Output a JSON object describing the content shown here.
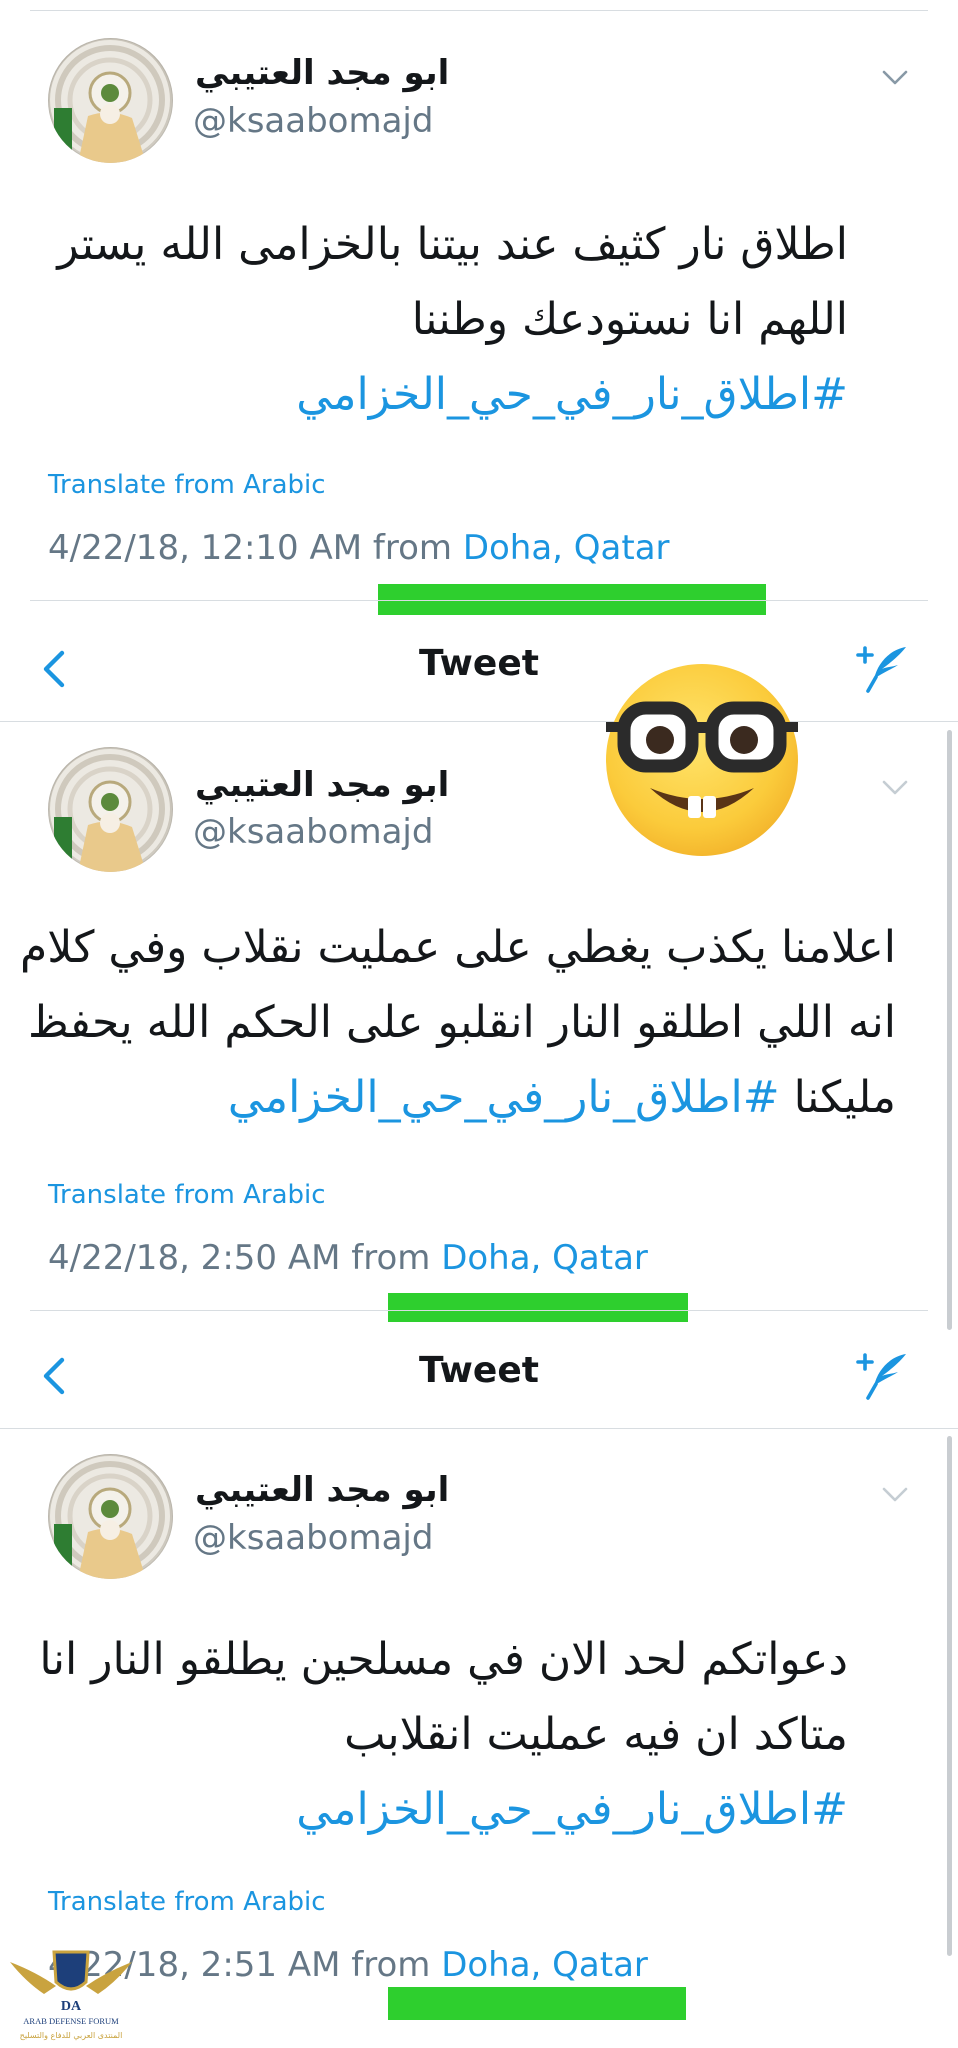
{
  "tweets": [
    {
      "author_name": "ابو مجد العتيبي",
      "author_handle": "@ksaabomajd",
      "lines": [
        "اطلاق نار كثيف عند بيتنا بالخزامى الله يستر",
        "اللهم انا نستودعك وطننا"
      ],
      "hashtag_line": "#اطلاق_نار_في_حي_الخزامي",
      "translate_label": "Translate from Arabic",
      "timestamp": "4/22/18, 12:10 AM from",
      "location": "Doha, Qatar"
    },
    {
      "author_name": "ابو مجد العتيبي",
      "author_handle": "@ksaabomajd",
      "lines": [
        "اعلامنا يكذب يغطي على عمليت نقلاب وفي كلام",
        "انه اللي اطلقو النار انقلبو على الحكم الله يحفظ"
      ],
      "last_line_text": "مليكنا",
      "hashtag_line": "#اطلاق_نار_في_حي_الخزامي",
      "translate_label": "Translate from Arabic",
      "timestamp": "4/22/18, 2:50 AM from",
      "location": "Doha, Qatar"
    },
    {
      "author_name": "ابو مجد العتيبي",
      "author_handle": "@ksaabomajd",
      "lines": [
        "دعواتكم لحد الان في مسلحين يطلقو النار انا",
        "متاكد ان فيه عمليت انقلابب"
      ],
      "hashtag_line": "#اطلاق_نار_في_حي_الخزامي",
      "translate_label": "Translate from Arabic",
      "timestamp": "4/22/18, 2:51 AM from",
      "location": "Doha, Qatar"
    }
  ],
  "navbar": {
    "title": "Tweet",
    "back_icon": "chevron-left-icon",
    "compose_icon": "compose-tweet-icon"
  },
  "colors": {
    "link_blue": "#1b95e0",
    "text_dark": "#14171a",
    "text_gray": "#657786",
    "redaction_green": "#2ecf2e",
    "divider": "#d8dde1"
  },
  "overlays": {
    "emoji": "nerd-face-emoji",
    "watermark": {
      "letters": "DA",
      "name": "ARAB DEFENSE FORUM",
      "arabic": "المنتدى العربي للدفاع والتسليح"
    }
  }
}
